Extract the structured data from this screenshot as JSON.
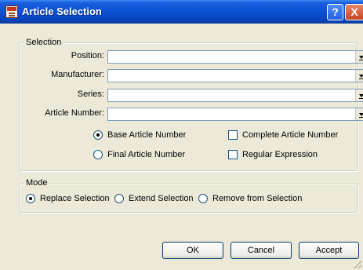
{
  "window": {
    "title": "Article Selection",
    "help_glyph": "?",
    "close_glyph": "X"
  },
  "selection": {
    "legend": "Selection",
    "fields": [
      {
        "label": "Position:",
        "value": ""
      },
      {
        "label": "Manufacturer:",
        "value": ""
      },
      {
        "label": "Series:",
        "value": ""
      },
      {
        "label": "Article Number:",
        "value": ""
      }
    ],
    "options": {
      "base_article_number": {
        "label": "Base Article Number",
        "selected": true
      },
      "final_article_number": {
        "label": "Final Article Number",
        "selected": false
      },
      "complete_article_number": {
        "label": "Complete Article Number",
        "checked": false
      },
      "regular_expression": {
        "label": "Regular Expression",
        "checked": false
      }
    }
  },
  "mode": {
    "legend": "Mode",
    "options": [
      {
        "label": "Replace Selection",
        "selected": true
      },
      {
        "label": "Extend Selection",
        "selected": false
      },
      {
        "label": "Remove from Selection",
        "selected": false
      }
    ]
  },
  "buttons": {
    "ok": "OK",
    "cancel": "Cancel",
    "accept": "Accept"
  }
}
